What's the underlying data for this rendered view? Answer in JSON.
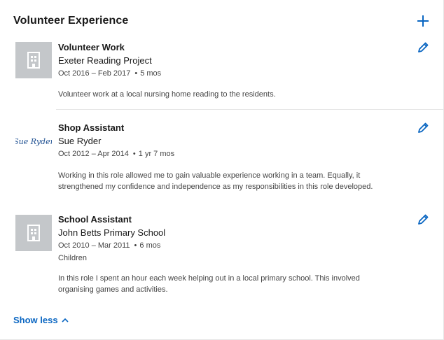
{
  "section": {
    "title": "Volunteer Experience",
    "add_icon": "plus-icon"
  },
  "entries": [
    {
      "title": "Volunteer Work",
      "organization": "Exeter Reading Project",
      "date_range": "Oct 2016 – Feb 2017",
      "duration": "5 mos",
      "cause": "",
      "description": "Volunteer work at a local nursing home reading to the residents.",
      "logo_icon": "building-icon",
      "edit_icon": "pencil-icon"
    },
    {
      "title": "Shop Assistant",
      "organization": "Sue Ryder",
      "date_range": "Oct 2012 – Apr 2014",
      "duration": "1 yr 7 mos",
      "cause": "",
      "description_line1": "Working in this role allowed me to gain valuable experience working in a team. Equally, it",
      "description_line2": "strengthened my confidence and independence as my responsibilities in this role developed.",
      "logo_text": "Sue Ryder",
      "edit_icon": "pencil-icon"
    },
    {
      "title": "School Assistant",
      "organization": "John Betts Primary School",
      "date_range": "Oct 2010 – Mar 2011",
      "duration": "6 mos",
      "cause": "Children",
      "description_line1": "In this role I spent an hour each week helping out in a local primary school. This involved",
      "description_line2": "organising games and activities.",
      "logo_icon": "building-icon",
      "edit_icon": "pencil-icon"
    }
  ],
  "footer": {
    "show_less_label": "Show less",
    "chevron_icon": "chevron-up-icon"
  },
  "colors": {
    "accent": "#0a66c2",
    "logo_placeholder": "#c4c7ca",
    "sue_ryder_brand": "#1d4f91"
  }
}
